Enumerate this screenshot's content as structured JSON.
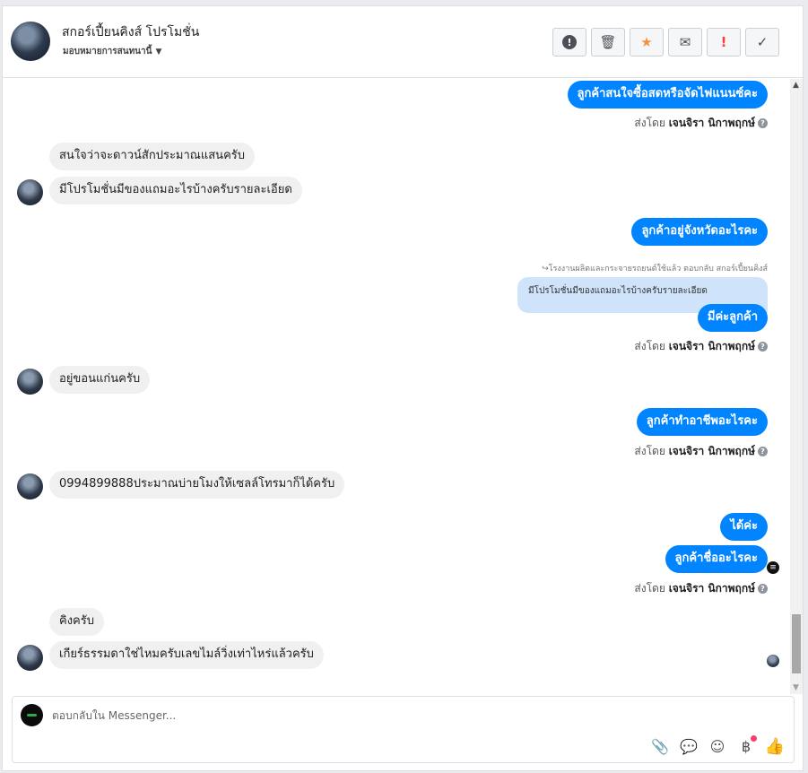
{
  "header": {
    "contact_name": "สกอร์เปี้ยนคิงส์ โปรโมชั่น",
    "assign_label": "มอบหมายการสนทนานี้",
    "actions": [
      {
        "name": "spam-icon",
        "glyph": "!"
      },
      {
        "name": "trash-icon",
        "glyph": "🗑"
      },
      {
        "name": "star-icon",
        "glyph": "★"
      },
      {
        "name": "mark-unread-icon",
        "glyph": "✉"
      },
      {
        "name": "follow-up-icon",
        "glyph": "!"
      },
      {
        "name": "done-check-icon",
        "glyph": "✓"
      }
    ]
  },
  "messages": {
    "m1": "ลูกค้าสนใจซื้อสดหรือจัดไฟแนนซ์คะ",
    "m2": "สนใจว่าจะดาวน์สักประมาณแสนครับ",
    "m3": "มีโปรโมชั่นมีของแถมอะไรบ้างครับรายละเอียด",
    "m4": "ลูกค้าอยู่จังหวัดอะไรคะ",
    "reply_note": "โรงงานผลิตและกระจายรถยนต์ใช้แล้ว ตอบกลับ สกอร์เปี้ยนคิงส์",
    "quoted": "มีโปรโมชั่นมีของแถมอะไรบ้างครับรายละเอียด",
    "m5": "มีค่ะลูกค้า",
    "m6": "อยู่ขอนแก่นครับ",
    "m7": "ลูกค้าทำอาชีพอะไรคะ",
    "m8": "0994899888ประมาณบ่ายโมงให้เซลล์โทรมาก็ได้ครับ",
    "m9": "ได้ค่ะ",
    "m10": "ลูกค้าชื่ออะไรคะ",
    "m11": "คิงครับ",
    "m12": "เกียร์ธรรมดาใช่ไหมครับเลขไมล์วิ่งเท่าไหร่แล้วครับ"
  },
  "sent_by": {
    "prefix": "ส่งโดย",
    "agent": "เจนจิรา นิกาพฤกษ์",
    "help_glyph": "?"
  },
  "composer": {
    "placeholder": "ตอบกลับใน Messenger...",
    "tools": [
      "paperclip-icon",
      "saved-replies-icon",
      "emoji-icon",
      "payment-baht-icon",
      "like-icon"
    ]
  },
  "colors": {
    "outgoing": "#0084ff",
    "incoming": "#f1f0f0",
    "star": "#f7923a",
    "urgent": "#fa3e3e"
  }
}
